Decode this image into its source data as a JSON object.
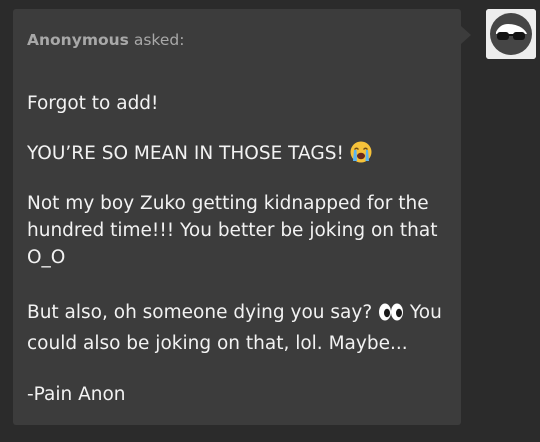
{
  "ask": {
    "asker": "Anonymous",
    "asked_label": "asked:",
    "paragraphs": {
      "p1": "Forgot to add!",
      "p2": "YOU’RE SO MEAN IN THOSE TAGS!",
      "p3": "Not my boy Zuko getting kidnapped for the hundred time!!! You better be joking on that O_O",
      "p4a": "But also, oh someone dying you say?",
      "p4b": "You could also be joking on that, lol. Maybe...",
      "p5": "-Pain Anon"
    }
  },
  "icons": {
    "crying_emoji": "loudly-crying-face-icon",
    "eyes_emoji": "eyes-icon",
    "avatar": "anonymous-sunglasses-avatar"
  },
  "colors": {
    "background": "#2b2b2b",
    "bubble": "#3c3c3c",
    "text": "#f2f2f2",
    "asker": "#a8a8a8"
  }
}
